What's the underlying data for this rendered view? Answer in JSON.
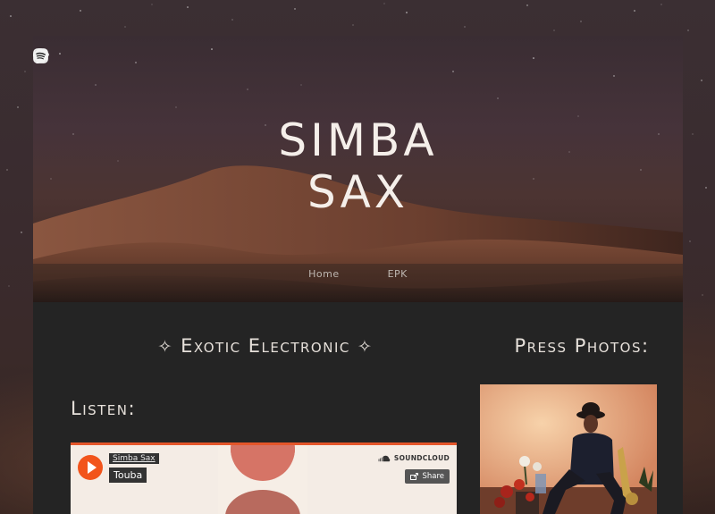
{
  "social": {
    "facebook": "facebook-icon",
    "instagram": "instagram-icon",
    "cloud": "cloud-icon",
    "soundcloud": "soundcloud-icon",
    "spotify": "spotify-icon"
  },
  "logo": {
    "line1": "SIMBA",
    "line2": "SAX"
  },
  "nav": {
    "items": [
      {
        "label": "Home"
      },
      {
        "label": "EPK"
      }
    ]
  },
  "genre": {
    "left_mark": "✧",
    "text": "Exotic Electronic",
    "right_mark": "✧"
  },
  "listen": {
    "title": "Listen:"
  },
  "player": {
    "artist": "Simba Sax",
    "track": "Touba",
    "brand": "SOUNDCLOUD",
    "share_label": "Share",
    "accent": "#f2541b"
  },
  "press": {
    "title": "Press Photos:"
  },
  "colors": {
    "page_bg": "#242424",
    "text": "#e6e0da",
    "soundcloud_orange": "#f2541b"
  }
}
